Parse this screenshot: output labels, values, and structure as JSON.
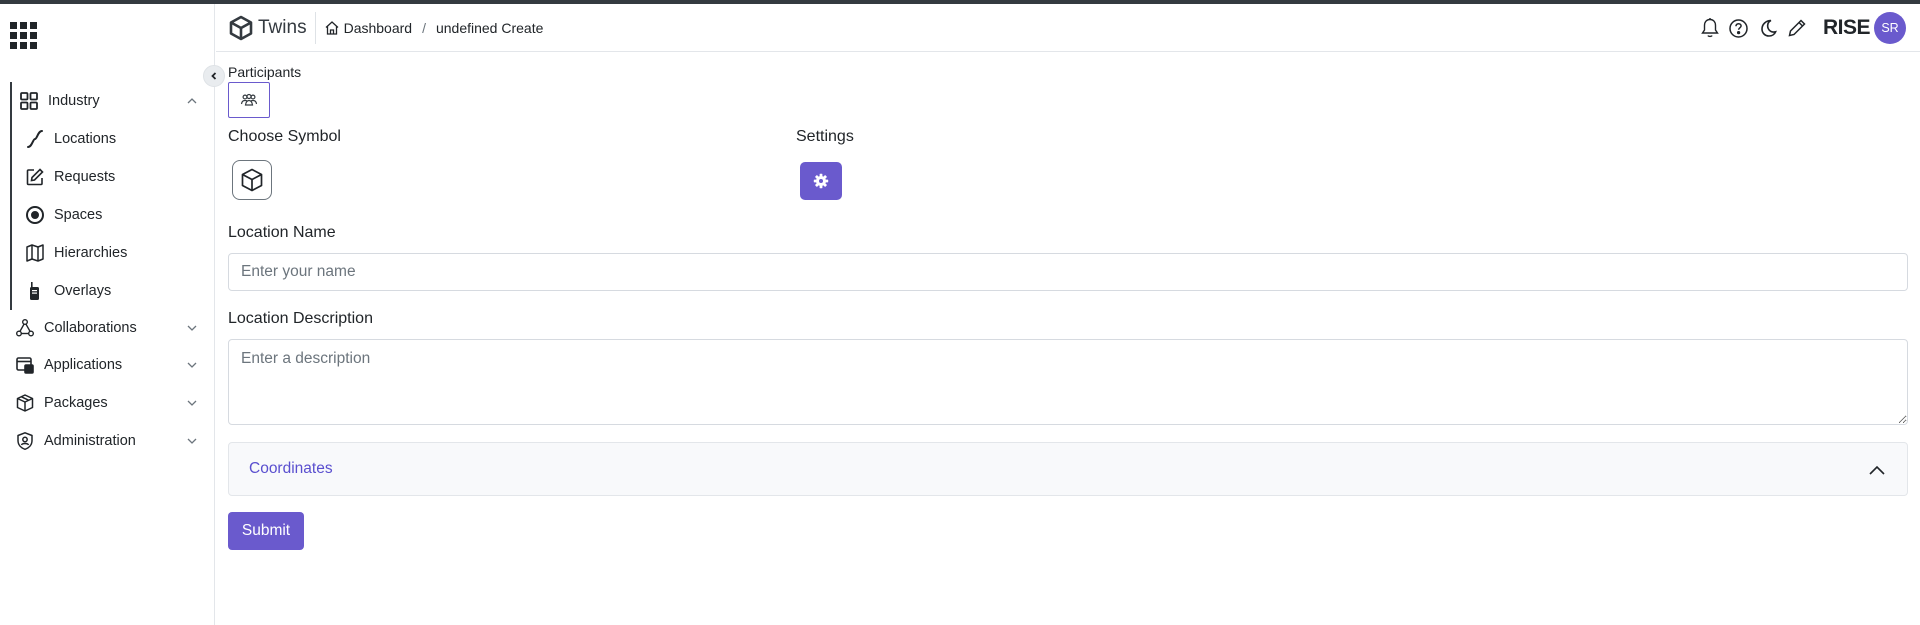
{
  "sidebar": {
    "groups": [
      {
        "label": "Industry",
        "icon": "grid-icon",
        "expanded": true,
        "children": [
          {
            "label": "Locations",
            "icon": "curve-icon"
          },
          {
            "label": "Requests",
            "icon": "pencil-square-icon"
          },
          {
            "label": "Spaces",
            "icon": "target-icon"
          },
          {
            "label": "Hierarchies",
            "icon": "map-icon"
          },
          {
            "label": "Overlays",
            "icon": "walkie-talkie-icon"
          }
        ]
      },
      {
        "label": "Collaborations",
        "icon": "network-icon",
        "expanded": false
      },
      {
        "label": "Applications",
        "icon": "app-window-icon",
        "expanded": false
      },
      {
        "label": "Packages",
        "icon": "box-icon",
        "expanded": false
      },
      {
        "label": "Administration",
        "icon": "shield-user-icon",
        "expanded": false
      }
    ]
  },
  "header": {
    "brand": "Twins",
    "breadcrumb": {
      "home": "Dashboard",
      "separator": "/",
      "current": "undefined Create"
    },
    "app_name": "RISE",
    "avatar_initials": "SR"
  },
  "form": {
    "participants_label": "Participants",
    "choose_symbol_label": "Choose Symbol",
    "settings_label": "Settings",
    "location_name_label": "Location Name",
    "location_name_placeholder": "Enter your name",
    "location_name_value": "",
    "location_description_label": "Location Description",
    "location_description_placeholder": "Enter a description",
    "location_description_value": "",
    "coordinates_label": "Coordinates",
    "coordinates_expanded": false,
    "submit_label": "Submit"
  },
  "colors": {
    "accent": "#6a5acd",
    "accordion_text": "#5a4fcf",
    "dark": "#343a40"
  }
}
